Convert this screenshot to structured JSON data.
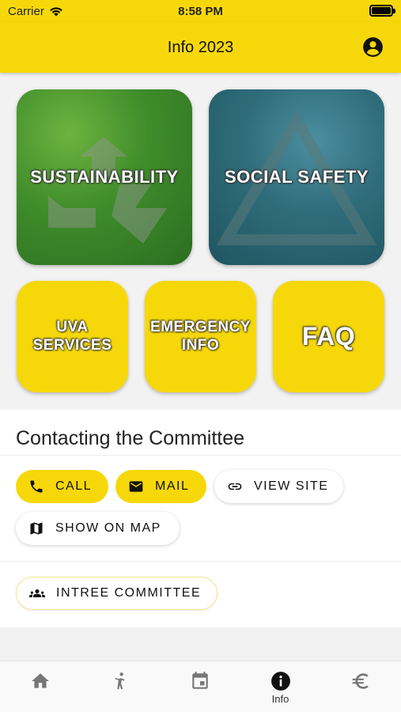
{
  "status_bar": {
    "carrier": "Carrier",
    "time": "8:58 PM"
  },
  "app_bar": {
    "title": "Info 2023"
  },
  "tiles": {
    "sustainability": "SUSTAINABILITY",
    "social_safety": "SOCIAL SAFETY",
    "uva_services": [
      "UVA",
      "SERVICES"
    ],
    "emergency_info": [
      "EMERGENCY",
      "INFO"
    ],
    "faq": "FAQ"
  },
  "contact": {
    "title": "Contacting the Committee",
    "call": "CALL",
    "mail": "MAIL",
    "view_site": "VIEW SITE",
    "show_on_map": "SHOW ON MAP",
    "committee": "INTREE COMMITTEE"
  },
  "bottom_nav": {
    "items": [
      {
        "icon": "home-icon",
        "label": ""
      },
      {
        "icon": "person-icon",
        "label": ""
      },
      {
        "icon": "calendar-icon",
        "label": ""
      },
      {
        "icon": "info-icon",
        "label": "Info",
        "active": true
      },
      {
        "icon": "euro-icon",
        "label": ""
      }
    ]
  },
  "colors": {
    "brand_yellow": "#f6d80a",
    "icon_inactive": "#777777",
    "icon_active": "#111111"
  }
}
